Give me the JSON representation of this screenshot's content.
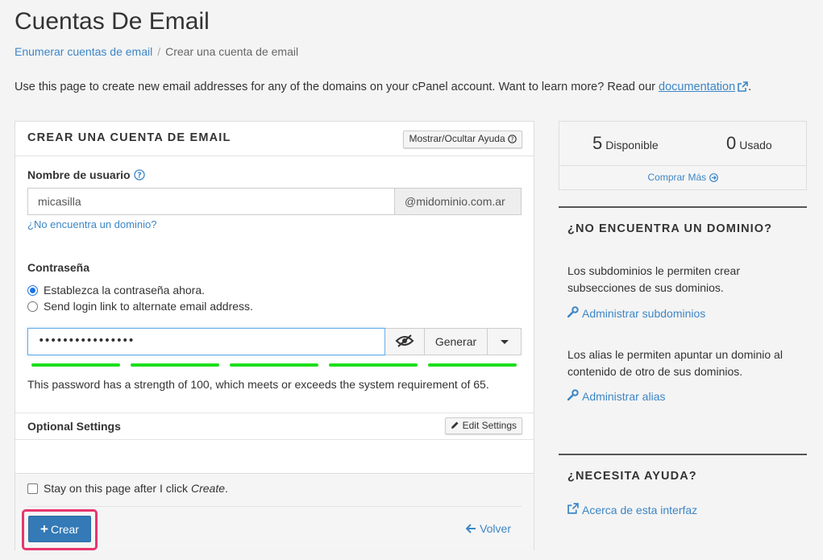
{
  "page": {
    "title": "Cuentas De Email",
    "breadcrumb": {
      "parent": "Enumerar cuentas de email",
      "current": "Crear una cuenta de email"
    },
    "intro": "Use this page to create new email addresses for any of the domains on your cPanel account. Want to learn more? Read our ",
    "intro_link": "documentation",
    "intro_end": "."
  },
  "form": {
    "header_title": "CREAR UNA CUENTA DE EMAIL",
    "help_toggle": "Mostrar/Ocultar Ayuda",
    "username_label": "Nombre de usuario",
    "username_value": "micasilla",
    "domain": "@midominio.com.ar",
    "missing_domain_link": "¿No encuentra un dominio?",
    "password_label": "Contraseña",
    "radio_set_now": "Establezca la contraseña ahora.",
    "radio_send_link": "Send login link to alternate email address.",
    "password_value": "••••••••••••••••",
    "generate_label": "Generar",
    "strength_message": "This password has a strength of 100, which meets or exceeds the system requirement of 65.",
    "strength_segments_filled": 5,
    "strength_color": "#1ddf1d",
    "optional_title": "Optional Settings",
    "edit_settings": "Edit Settings",
    "stay_label_pre": "Stay on this page after I click ",
    "stay_label_em": "Create",
    "stay_label_post": ".",
    "create_label": "Crear",
    "back_label": "Volver"
  },
  "stats": {
    "available_num": "5",
    "available_label": "Disponible",
    "used_num": "0",
    "used_label": "Usado",
    "buy_more": "Comprar Más"
  },
  "sidebar": {
    "domain_heading": "¿NO ENCUENTRA UN DOMINIO?",
    "subdomains_text": "Los subdominios le permiten crear subsecciones de sus dominios.",
    "subdomains_link": "Administrar subdominios",
    "alias_text": "Los alias le permiten apuntar un dominio al contenido de otro de sus dominios.",
    "alias_link": "Administrar alias",
    "help_heading": "¿NECESITA AYUDA?",
    "help_link": "Acerca de esta interfaz"
  },
  "colors": {
    "link": "#3d86c6",
    "primary": "#337ab7",
    "highlight": "#e8366d"
  }
}
